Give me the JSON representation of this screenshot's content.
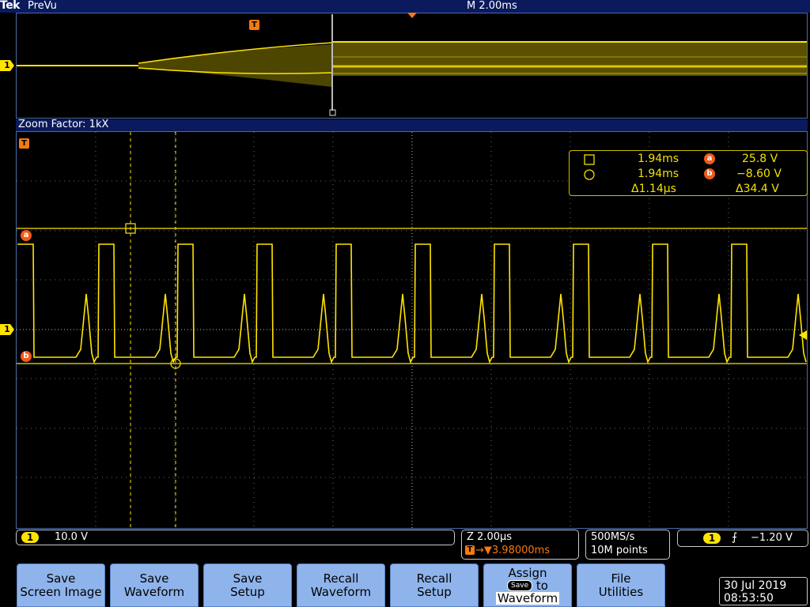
{
  "header": {
    "brand": "Tek",
    "mode": "PreVu",
    "timebase": "M 2.00ms"
  },
  "zoom": {
    "label": "Zoom Factor: 1kX"
  },
  "markers": {
    "channel": "1",
    "trigger": "T",
    "cursor_a": "a",
    "cursor_b": "b"
  },
  "cursor_readout": {
    "row1_time": "1.94ms",
    "row1_cursor": "a",
    "row1_value": "25.8 V",
    "row2_time": "1.94ms",
    "row2_cursor": "b",
    "row2_value": "−8.60 V",
    "delta_time": "Δ1.14µs",
    "delta_value": "Δ34.4 V"
  },
  "status": {
    "ch1_badge": "1",
    "ch1_scale": "10.0 V",
    "zoom_scale": "Z 2.00µs",
    "zoom_position": "→▼3.98000ms",
    "sample_rate": "500MS/s",
    "record_length": "10M points",
    "trigger_badge": "1",
    "trigger_slope": "⨍",
    "trigger_level": "−1.20 V"
  },
  "softkeys": [
    {
      "line1": "Save",
      "line2": "Screen Image"
    },
    {
      "line1": "Save",
      "line2": "Waveform"
    },
    {
      "line1": "Save",
      "line2": "Setup"
    },
    {
      "line1": "Recall",
      "line2": "Waveform"
    },
    {
      "line1": "Recall",
      "line2": "Setup"
    },
    {
      "line1": "Assign",
      "chip": "Save",
      "mid": "to",
      "line2": "Waveform"
    },
    {
      "line1": "File",
      "line2": "Utilities"
    }
  ],
  "datetime": {
    "date": "30 Jul  2019",
    "time": "08:53:50"
  },
  "colors": {
    "trace": "#ffe400",
    "marker": "#f05a1a",
    "softkey": "#8fb4ec",
    "statusbar": "#0a1a5c"
  }
}
